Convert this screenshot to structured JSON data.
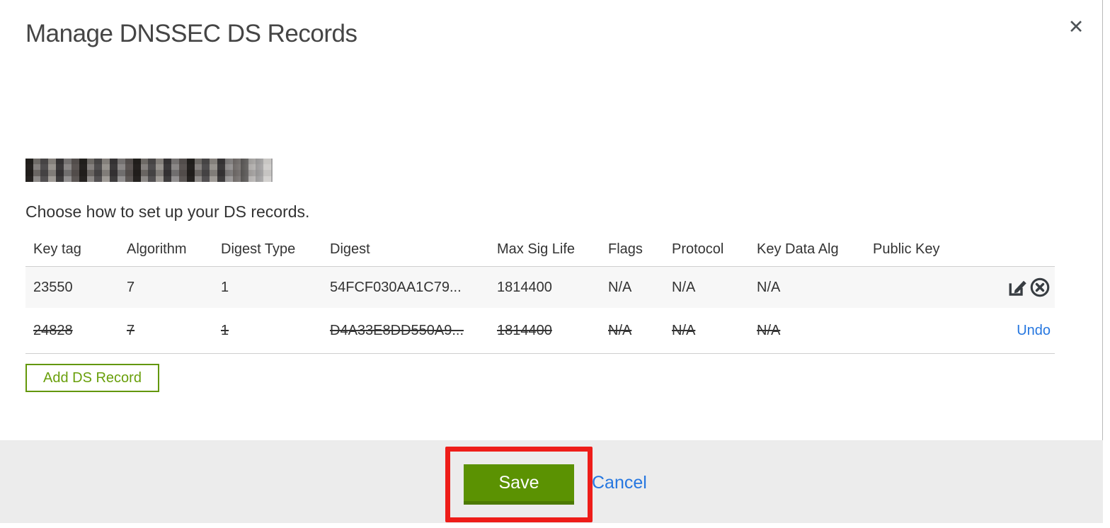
{
  "modal": {
    "title": "Manage DNSSEC DS Records",
    "close_label": "✕",
    "instruction": "Choose how to set up your DS records."
  },
  "table": {
    "headers": [
      "Key tag",
      "Algorithm",
      "Digest Type",
      "Digest",
      "Max Sig Life",
      "Flags",
      "Protocol",
      "Key Data Alg",
      "Public Key"
    ],
    "rows": [
      {
        "key_tag": "23550",
        "algorithm": "7",
        "digest_type": "1",
        "digest": "54FCF030AA1C79...",
        "max_sig_life": "1814400",
        "flags": "N/A",
        "protocol": "N/A",
        "key_data_alg": "N/A",
        "public_key": "",
        "struck": false,
        "actions": [
          "edit",
          "delete"
        ]
      },
      {
        "key_tag": "24828",
        "algorithm": "7",
        "digest_type": "1",
        "digest": "D4A33E8DD550A9...",
        "max_sig_life": "1814400",
        "flags": "N/A",
        "protocol": "N/A",
        "key_data_alg": "N/A",
        "public_key": "",
        "struck": true,
        "action_label": "Undo"
      }
    ]
  },
  "buttons": {
    "add_ds_record": "Add DS Record",
    "save": "Save",
    "cancel": "Cancel"
  },
  "colors": {
    "accent_green": "#5b9202",
    "outline_green": "#699f0b",
    "link_blue": "#2677e0",
    "annotation_red": "#ee1d19",
    "row_alt_bg": "#f7f7f7",
    "footer_bg": "#ececec"
  }
}
